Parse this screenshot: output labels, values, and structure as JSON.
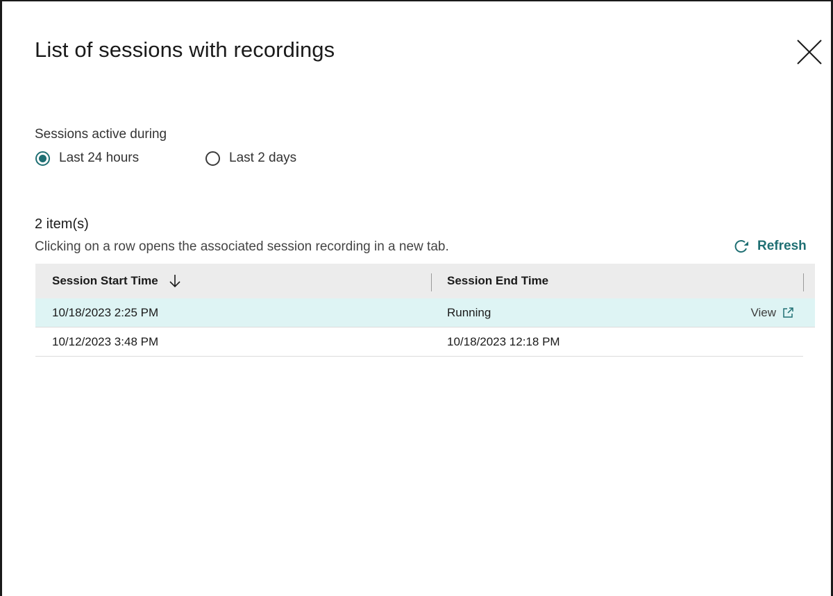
{
  "dialog": {
    "title": "List of sessions with recordings",
    "close_icon": "close-icon"
  },
  "filter": {
    "label": "Sessions active during",
    "options": [
      {
        "label": "Last 24 hours",
        "selected": true
      },
      {
        "label": "Last 2 days",
        "selected": false
      }
    ]
  },
  "results": {
    "count": "2 item(s)",
    "hint": "Clicking on a row opens the associated session recording in a new tab.",
    "refresh_label": "Refresh",
    "refresh_icon": "refresh-icon"
  },
  "table": {
    "columns": [
      "Session Start Time",
      "Session End Time"
    ],
    "sort_icon": "arrow-down-icon",
    "rows": [
      {
        "start": "10/18/2023 2:25 PM",
        "end": "Running",
        "action": "View"
      },
      {
        "start": "10/12/2023 3:48 PM",
        "end": "10/18/2023 12:18 PM"
      }
    ],
    "action_icon": "external-link-icon"
  },
  "colors": {
    "accent": "#1f6f73",
    "header_bg": "#ececec",
    "highlight_row": "#def4f4"
  }
}
